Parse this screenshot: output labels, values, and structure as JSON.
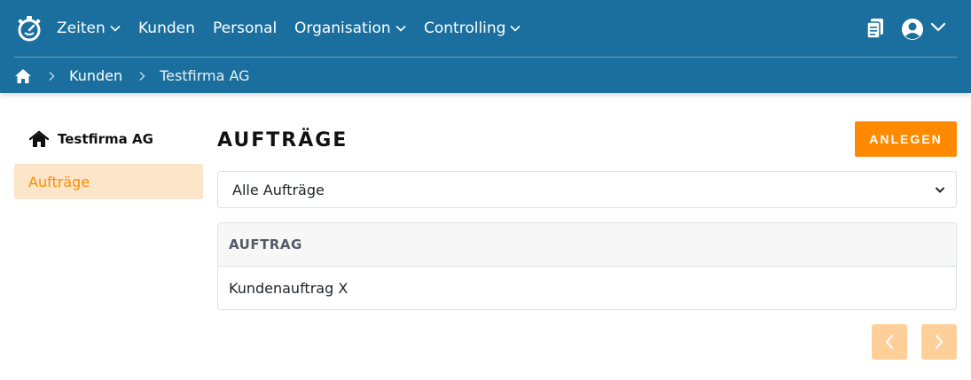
{
  "colors": {
    "header_bg": "#1a6f9e",
    "accent": "#ff8a00",
    "sidebar_active_bg": "#fde5c9",
    "pager_bg": "#ffcf99"
  },
  "nav": {
    "logo_icon": "stopwatch-icon",
    "items": [
      {
        "label": "Zeiten",
        "has_dropdown": true
      },
      {
        "label": "Kunden",
        "has_dropdown": false
      },
      {
        "label": "Personal",
        "has_dropdown": false
      },
      {
        "label": "Organisation",
        "has_dropdown": true
      },
      {
        "label": "Controlling",
        "has_dropdown": true
      }
    ],
    "right_icons": [
      "clipboard-icon",
      "user-circle-icon",
      "chevron-down-icon"
    ]
  },
  "breadcrumb": {
    "home_icon": "home-icon",
    "items": [
      "Kunden",
      "Testfirma AG"
    ]
  },
  "sidebar": {
    "title": "Testfirma AG",
    "title_icon": "house-icon",
    "items": [
      {
        "label": "Aufträge",
        "active": true
      }
    ]
  },
  "main": {
    "title": "AUFTRÄGE",
    "create_button": "ANLEGEN",
    "filter": {
      "selected": "Alle Aufträge"
    },
    "table": {
      "columns": [
        "AUFTRAG"
      ],
      "rows": [
        [
          "Kundenauftrag X"
        ]
      ]
    },
    "pagination": {
      "prev_icon": "chevron-left-icon",
      "next_icon": "chevron-right-icon"
    }
  }
}
